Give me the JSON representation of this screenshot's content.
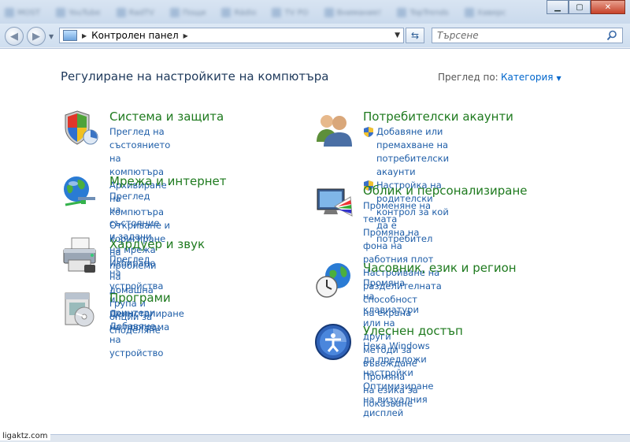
{
  "window": {
    "blur_tabs": [
      "MOST",
      "YouTube",
      "RadTV",
      "Пощи",
      "Rádio",
      "TV PO",
      "Внимание!",
      "TopTrends",
      "Хаверс",
      "facebook"
    ],
    "min_label": "▁",
    "max_label": "▢",
    "close_label": "✕"
  },
  "address": {
    "breadcrumb": "Контролен панел",
    "search_placeholder": "Търсене"
  },
  "header": {
    "title": "Регулиране на настройките на компютъра",
    "view_by_label": "Преглед по:",
    "view_by_value": "Категория"
  },
  "categories": [
    {
      "title": "Система и защита",
      "links": [
        "Преглед на състоянието на компютъра",
        "Архивиране на компютъра",
        "Откриване и коригиране на проблеми"
      ]
    },
    {
      "title": "Мрежа и интернет",
      "links": [
        "Преглед на състояние и задачи на мрежа",
        "Избиране на домашна група и опции за",
        "споделяне"
      ]
    },
    {
      "title": "Хардуер и звук",
      "links": [
        "Преглед на устройства и принтери",
        "Добавяне на устройство"
      ]
    },
    {
      "title": "Програми",
      "links": [
        "Деинсталиране на програма"
      ]
    },
    {
      "title": "Потребителски акаунти",
      "links": [
        "Добавяне или премахване на",
        "потребителски акаунти",
        "Настройка на родителски контрол за кой",
        "да е потребител"
      ]
    },
    {
      "title": "Облик и персонализиране",
      "links": [
        "Променяне на темата",
        "Промяна на фона на работния плот",
        "Настройване на разделителната способност",
        "на екрана"
      ]
    },
    {
      "title": "Часовник, език и регион",
      "links": [
        "Промяна на клавиатури или на други",
        "методи за въвеждане",
        "Промяна на езика за показване"
      ]
    },
    {
      "title": "Улеснен достъп",
      "links": [
        "Нека Windows да предложи настройки",
        "Оптимизиране на визуалния дисплей"
      ]
    }
  ],
  "watermark": "ligaktz.com",
  "icons": {
    "system": "shield-icon",
    "network": "globe-network-icon",
    "hardware": "printer-icon",
    "programs": "programs-disc-icon",
    "users": "users-icon",
    "appearance": "monitor-palette-icon",
    "clock": "clock-globe-icon",
    "access": "accessibility-icon"
  }
}
